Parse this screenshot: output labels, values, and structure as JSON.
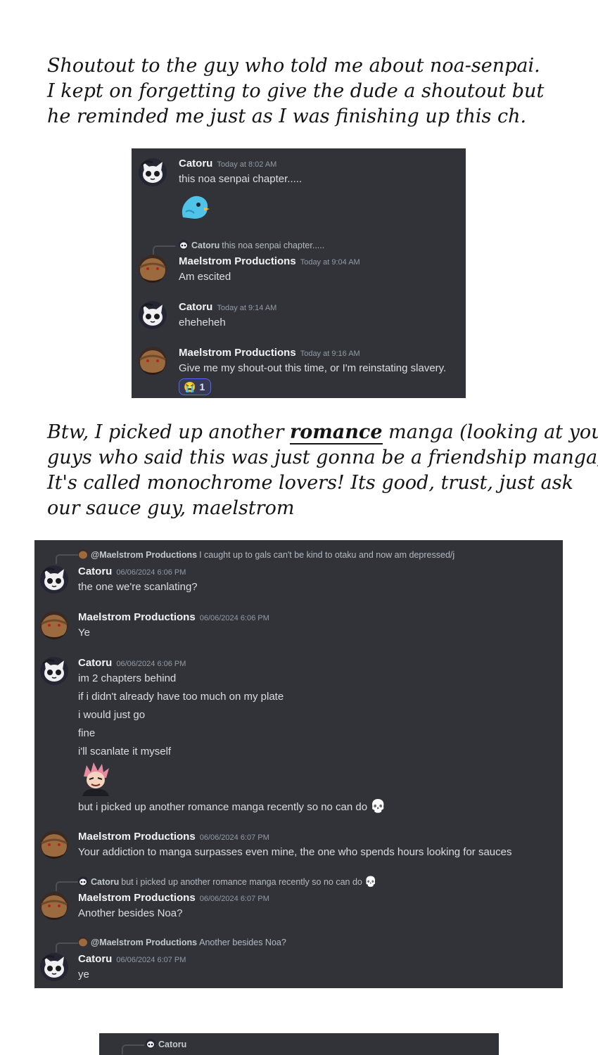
{
  "note1": {
    "lines": [
      "Shoutout to the guy who told me about noa-senpai.",
      "I kept on forgetting to give the dude a shoutout but",
      "he reminded me just as I was finishing up this ch."
    ]
  },
  "chat1": {
    "messages": [
      {
        "author": "Catoru",
        "time": "Today at 8:02 AM",
        "lines": [
          "this noa senpai chapter....."
        ]
      },
      {
        "reply": {
          "author": "Catoru",
          "text": "this noa senpai chapter....."
        },
        "author": "Maelstrom Productions",
        "time": "Today at 9:04 AM",
        "lines": [
          "Am escited"
        ]
      },
      {
        "author": "Catoru",
        "time": "Today at 9:14 AM",
        "lines": [
          "eheheheh"
        ]
      },
      {
        "author": "Maelstrom Productions",
        "time": "Today at 9:16 AM",
        "lines": [
          "Give me my shout-out this time, or I'm reinstating slavery."
        ],
        "reaction": {
          "emoji": "😭",
          "count": "1"
        }
      }
    ],
    "sticker_icon": "blue-bird-sticker"
  },
  "note2": {
    "l1_pre": "Btw, I picked up another ",
    "l1_emph": "romance",
    "l1_post": " manga (looking at you",
    "l2": "guys who said this was just gonna be a friendship manga).",
    "l3": "It's called monochrome lovers! Its good, trust, just ask",
    "l4": "our sauce guy, maelstrom"
  },
  "chat2": {
    "messages": [
      {
        "reply": {
          "author": "@Maelstrom Productions",
          "text": "I caught up to gals can't be kind to otaku and now am depressed/j"
        },
        "author": "Catoru",
        "time": "06/06/2024 6:06 PM",
        "lines": [
          "the one we're scanlating?"
        ]
      },
      {
        "author": "Maelstrom Productions",
        "time": "06/06/2024 6:06 PM",
        "lines": [
          "Ye"
        ]
      },
      {
        "author": "Catoru",
        "time": "06/06/2024 6:06 PM",
        "lines": [
          "im 2 chapters behind",
          "if i didn't already have too much on my plate",
          "i would just go",
          "fine",
          "i'll scanlate it myself",
          "but i picked up another romance manga recently so no can do"
        ]
      },
      {
        "author": "Maelstrom Productions",
        "time": "06/06/2024 6:07 PM",
        "lines": [
          "Your addiction to manga surpasses even mine, the one who spends hours looking for sauces"
        ]
      },
      {
        "reply": {
          "author": "Catoru",
          "text": "but i picked up another romance manga recently so no can do"
        },
        "author": "Maelstrom Productions",
        "time": "06/06/2024 6:07 PM",
        "lines": [
          "Another besides Noa?"
        ]
      },
      {
        "reply": {
          "author": "@Maelstrom Productions",
          "text": "Another besides Noa?"
        },
        "author": "Catoru",
        "time": "06/06/2024 6:07 PM",
        "lines": [
          "ye"
        ]
      }
    ],
    "skull_emoji": "💀",
    "sticker_icon": "pink-haired-character-sticker"
  },
  "chat3": {
    "reply": {
      "author": "Catoru"
    }
  }
}
